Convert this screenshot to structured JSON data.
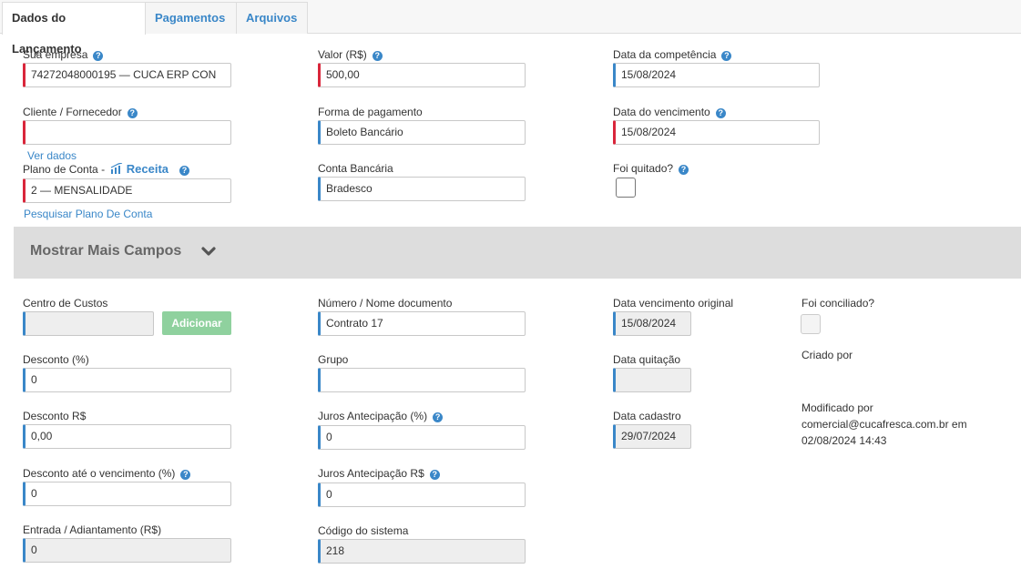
{
  "tabs": [
    "Dados do Lançamento",
    "Pagamentos",
    "Arquivos"
  ],
  "fields": {
    "empresa": {
      "label": "Sua empresa",
      "value": "74272048000195 — CUCA ERP CON"
    },
    "valor": {
      "label": "Valor (R$)",
      "value": "500,00"
    },
    "competencia": {
      "label": "Data da competência",
      "value": "15/08/2024"
    },
    "cliente": {
      "label": "Cliente / Fornecedor",
      "value": "",
      "link": "Ver dados"
    },
    "forma_pagamento": {
      "label": "Forma de pagamento",
      "value": "Boleto Bancário"
    },
    "vencimento": {
      "label": "Data do vencimento",
      "value": "15/08/2024"
    },
    "plano_conta": {
      "label": "Plano de Conta -",
      "badge": "Receita",
      "value": "2 — MENSALIDADE",
      "link": "Pesquisar Plano De Conta"
    },
    "conta_bancaria": {
      "label": "Conta Bancária",
      "value": "Bradesco"
    },
    "quitado": {
      "label": "Foi quitado?"
    }
  },
  "more": {
    "title": "Mostrar Mais Campos"
  },
  "extra": {
    "centro_custos": {
      "label": "Centro de Custos",
      "value": "",
      "button": "Adicionar"
    },
    "numero_documento": {
      "label": "Número / Nome documento",
      "value": "Contrato 17"
    },
    "vencimento_original": {
      "label": "Data vencimento original",
      "value": "15/08/2024"
    },
    "conciliado": {
      "label": "Foi conciliado?"
    },
    "desconto_pct": {
      "label": "Desconto (%)",
      "value": "0"
    },
    "grupo": {
      "label": "Grupo",
      "value": ""
    },
    "data_quitacao": {
      "label": "Data quitação",
      "value": ""
    },
    "criado_por": {
      "label": "Criado por"
    },
    "desconto_rs": {
      "label": "Desconto R$",
      "value": "0,00"
    },
    "juros_pct": {
      "label": "Juros Antecipação (%)",
      "value": "0"
    },
    "data_cadastro": {
      "label": "Data cadastro",
      "value": "29/07/2024"
    },
    "modificado_por": {
      "label": "Modificado por",
      "line1": "comercial@cucafresca.com.br em",
      "line2": "02/08/2024 14:43"
    },
    "desconto_venc": {
      "label": "Desconto até o vencimento (%)",
      "value": "0"
    },
    "juros_rs": {
      "label": "Juros Antecipação R$",
      "value": "0"
    },
    "entrada": {
      "label": "Entrada / Adiantamento (R$)",
      "value": "0"
    },
    "codigo_sistema": {
      "label": "Código do sistema",
      "value": "218"
    }
  },
  "colors": {
    "accent": "#3a87c8",
    "required": "#d9263b",
    "add_button": "#8fd19e",
    "more_bar": "#dddddd"
  }
}
